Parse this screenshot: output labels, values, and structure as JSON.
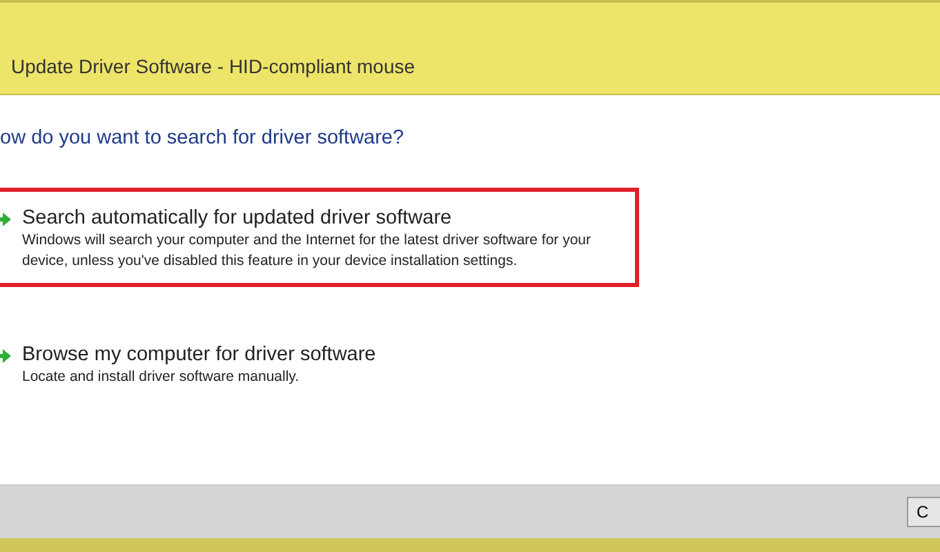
{
  "window": {
    "title": "Update Driver Software - HID-compliant mouse"
  },
  "heading": "ow do you want to search for driver software?",
  "options": [
    {
      "title": "Search automatically for updated driver software",
      "description": "Windows will search your computer and the Internet for the latest driver software for your device, unless you've disabled this feature in your device installation settings.",
      "selected": true
    },
    {
      "title": "Browse my computer for driver software",
      "description": "Locate and install driver software manually.",
      "selected": false
    }
  ],
  "buttons": [
    "C"
  ]
}
